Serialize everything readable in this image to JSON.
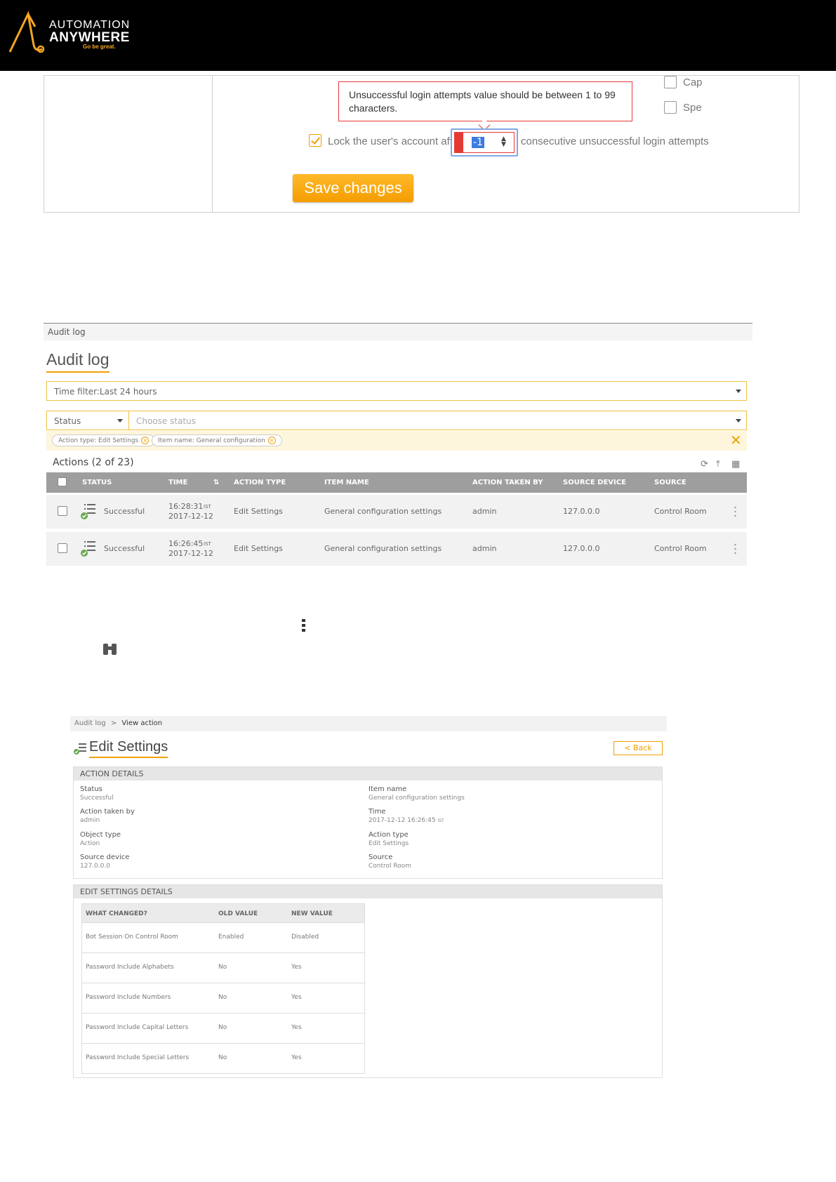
{
  "brand": {
    "name_line1": "AUTOMATION",
    "name_line2": "ANYWHERE",
    "tagline": "Go be great.",
    "accent_color": "#f5a623"
  },
  "password_settings": {
    "checkbox_capital": "Cap",
    "checkbox_special": "Spe",
    "error_tooltip": "Unsuccessful login attempts value should be between 1 to 99 characters.",
    "lock_label_before": "Lock the user's account after",
    "lock_value": "-1",
    "lock_label_after": "consecutive unsuccessful login attempts",
    "lock_checked": true,
    "save_button": "Save changes",
    "error_color": "#e53935"
  },
  "audit_log": {
    "breadcrumb": "Audit log",
    "title": "Audit log",
    "time_filter": "Time filter:Last 24 hours",
    "filter_field": "Status",
    "filter_placeholder": "Choose status",
    "chips": [
      "Action type: Edit Settings",
      "Item name: General configuration"
    ],
    "actions_count": "Actions (2 of 23)",
    "toolbar_icons": [
      "refresh-icon",
      "export-icon",
      "columns-icon"
    ],
    "columns": [
      "STATUS",
      "TIME",
      "ACTION TYPE",
      "ITEM NAME",
      "ACTION TAKEN BY",
      "SOURCE DEVICE",
      "SOURCE"
    ],
    "rows": [
      {
        "status": "Successful",
        "time": "16:28:31",
        "tz": "IST",
        "date": "2017-12-12",
        "action_type": "Edit Settings",
        "item_name": "General configuration settings",
        "taken_by": "admin",
        "device": "127.0.0.0",
        "source": "Control Room"
      },
      {
        "status": "Successful",
        "time": "16:26:45",
        "tz": "IST",
        "date": "2017-12-12",
        "action_type": "Edit Settings",
        "item_name": "General configuration settings",
        "taken_by": "admin",
        "device": "127.0.0.0",
        "source": "Control Room"
      }
    ]
  },
  "view_action": {
    "breadcrumb_parent": "Audit log",
    "breadcrumb_sep": ">",
    "breadcrumb_current": "View action",
    "title": "Edit Settings",
    "back_button": "< Back",
    "action_details_header": "ACTION DETAILS",
    "fields_left": [
      {
        "key": "Status",
        "value": "Successful"
      },
      {
        "key": "Action taken by",
        "value": "admin"
      },
      {
        "key": "Object type",
        "value": "Action"
      },
      {
        "key": "Source device",
        "value": "127.0.0.0"
      }
    ],
    "fields_right": [
      {
        "key": "Item name",
        "value": "General configuration settings"
      },
      {
        "key": "Time",
        "value": "2017-12-12 16:26:45",
        "tz": "IST"
      },
      {
        "key": "Action type",
        "value": "Edit Settings"
      },
      {
        "key": "Source",
        "value": "Control Room"
      }
    ],
    "edit_details_header": "EDIT SETTINGS DETAILS",
    "changes_columns": [
      "WHAT CHANGED?",
      "OLD VALUE",
      "NEW VALUE"
    ],
    "changes": [
      {
        "what": "Bot Session On Control Room",
        "old": "Enabled",
        "new": "Disabled"
      },
      {
        "what": "Password Include Alphabets",
        "old": "No",
        "new": "Yes"
      },
      {
        "what": "Password Include Numbers",
        "old": "No",
        "new": "Yes"
      },
      {
        "what": "Password Include Capital Letters",
        "old": "No",
        "new": "Yes"
      },
      {
        "what": "Password Include Special Letters",
        "old": "No",
        "new": "Yes"
      }
    ]
  }
}
